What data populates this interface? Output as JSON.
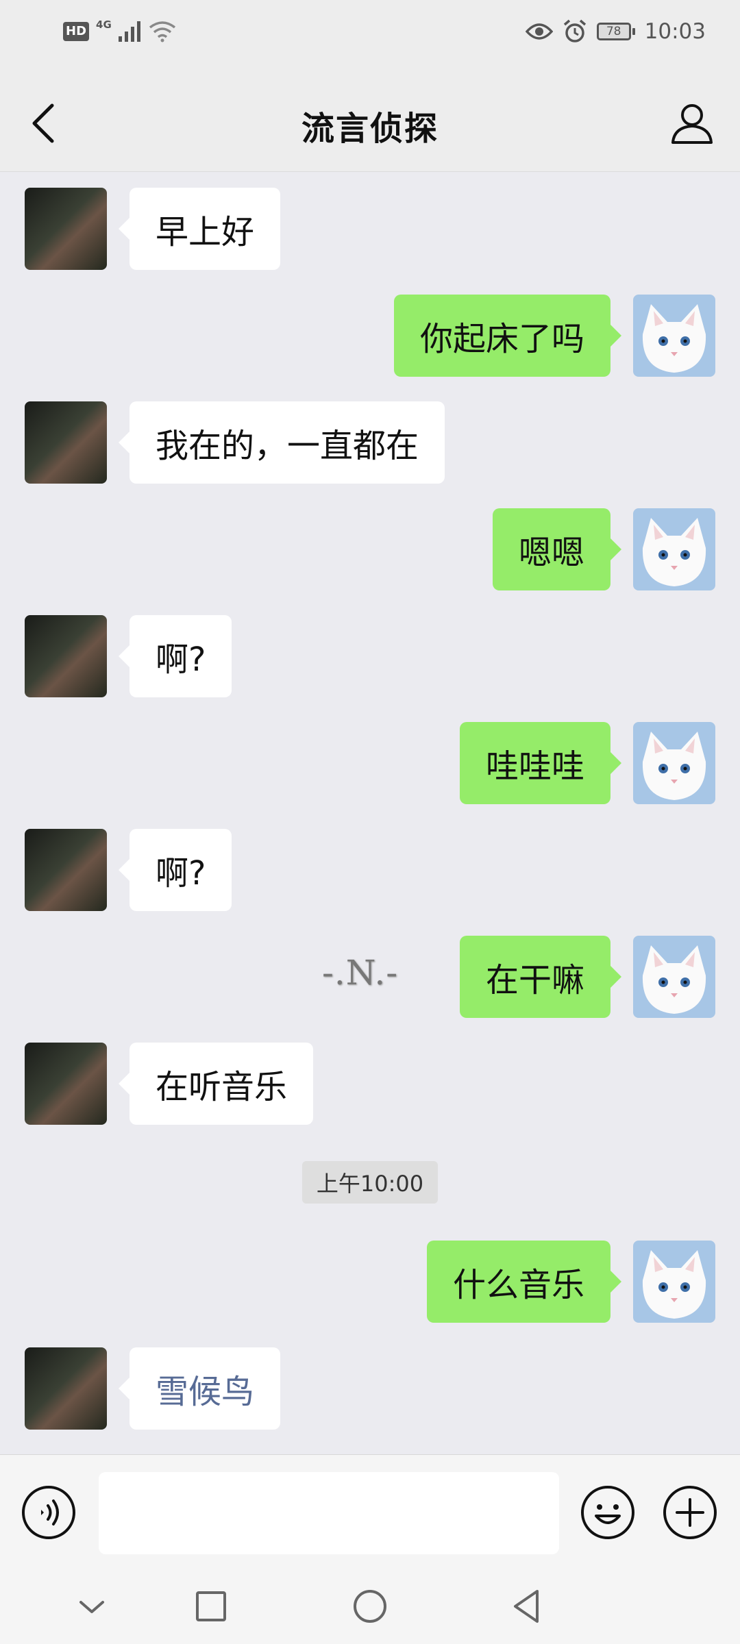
{
  "status_bar": {
    "hd": "HD",
    "network": "4G",
    "battery": "78",
    "time": "10:03"
  },
  "header": {
    "title": "流言侦探"
  },
  "messages": [
    {
      "side": "left",
      "text": "早上好"
    },
    {
      "side": "right",
      "text": "你起床了吗"
    },
    {
      "side": "left",
      "text": "我在的，一直都在"
    },
    {
      "side": "right",
      "text": "嗯嗯"
    },
    {
      "side": "left",
      "text": "啊?"
    },
    {
      "side": "right",
      "text": "哇哇哇"
    },
    {
      "side": "left",
      "text": "啊?"
    },
    {
      "side": "right",
      "text": "在干嘛"
    },
    {
      "side": "left",
      "text": "在听音乐"
    },
    {
      "side": "right",
      "text": "什么音乐"
    },
    {
      "side": "left",
      "text": "雪候鸟"
    }
  ],
  "timestamp": "上午10:00",
  "watermark": "-.N.-",
  "input": {
    "value": ""
  },
  "colors": {
    "background": "#ebebf0",
    "bubble_sent": "#95ec69",
    "bubble_received": "#ffffff",
    "link": "#576b95"
  },
  "icons": [
    "back-arrow-icon",
    "profile-icon",
    "voice-icon",
    "emoji-icon",
    "plus-icon",
    "hide-keyboard-icon",
    "recents-icon",
    "home-icon",
    "back-nav-icon"
  ]
}
